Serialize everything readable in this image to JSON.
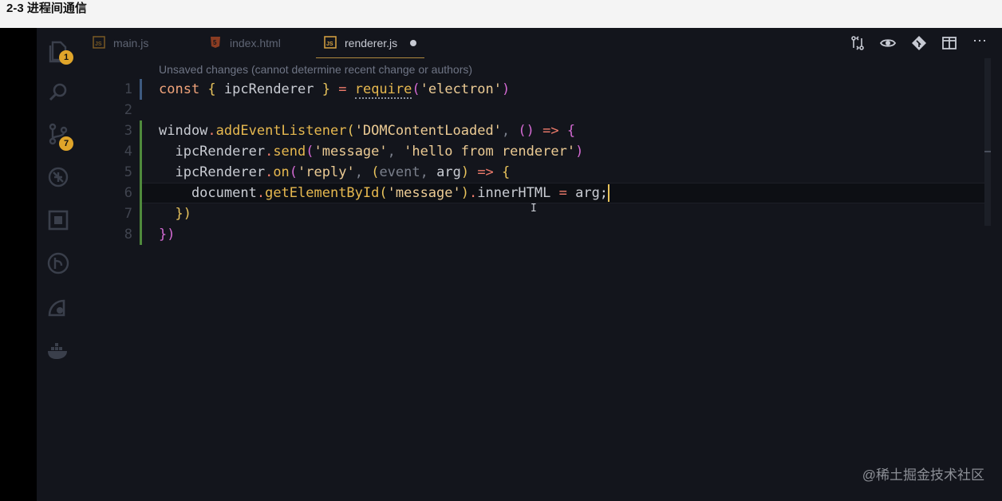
{
  "video": {
    "title": "2-3 进程间通信"
  },
  "activity_bar": {
    "explorer_badge": "1",
    "source_control_badge": "7",
    "icons": [
      "files-icon",
      "search-icon",
      "source-control-icon",
      "debug-icon",
      "extensions-icon",
      "gitlens-icon",
      "remote-explorer-icon",
      "docker-icon"
    ]
  },
  "tabs": [
    {
      "label": "main.js",
      "icon": "js-file-icon"
    },
    {
      "label": "index.html",
      "icon": "html5-file-icon"
    },
    {
      "label": "renderer.js",
      "icon": "js-file-icon",
      "active": true,
      "unsaved": true
    }
  ],
  "toolbar": {
    "icons": [
      "compare-changes-icon",
      "open-preview-icon",
      "git-commit-icon",
      "split-editor-icon",
      "more-actions-icon"
    ],
    "more_label": "⋯"
  },
  "editor": {
    "hint": "Unsaved changes (cannot determine recent change or authors)",
    "line_numbers": [
      "1",
      "2",
      "3",
      "4",
      "5",
      "6",
      "7",
      "8"
    ],
    "lines": {
      "l1": {
        "a": "const",
        "b": " { ",
        "c": "ipcRenderer",
        "d": " } ",
        "e": "=",
        "f": " ",
        "g": "require",
        "h": "(",
        "i": "'electron'",
        "j": ")"
      },
      "l3": {
        "a": "window",
        "b": ".",
        "c": "addEventListener",
        "d": "(",
        "e": "'DOMContentLoaded'",
        "f": ", ",
        "g": "()",
        "h": " => ",
        "i": "{"
      },
      "l4": {
        "a": "  ipcRenderer",
        "b": ".",
        "c": "send",
        "d": "(",
        "e": "'message'",
        "f": ", ",
        "g": "'hello from renderer'",
        "h": ")"
      },
      "l5": {
        "a": "  ipcRenderer",
        "b": ".",
        "c": "on",
        "d": "(",
        "e": "'reply'",
        "f": ", ",
        "g": "(",
        "h": "event",
        "i": ", ",
        "j": "arg",
        "k": ")",
        "l": " => ",
        "m": "{"
      },
      "l6": {
        "a": "    document",
        "b": ".",
        "c": "getElementById",
        "d": "(",
        "e": "'message'",
        "f": ")",
        "g": ".",
        "h": "innerHTML",
        "i": " = ",
        "j": "arg;"
      },
      "l7": {
        "a": "  })"
      },
      "l8": {
        "a": "})"
      }
    }
  },
  "watermark": "@稀土掘金技术社区",
  "colors": {
    "background": "#13151c",
    "accent": "#e0a52a"
  }
}
